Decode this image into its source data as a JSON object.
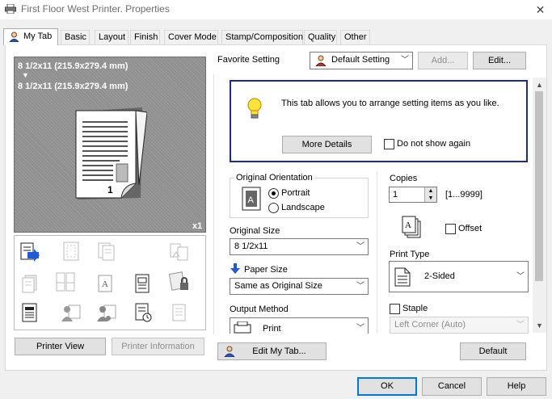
{
  "window": {
    "title": "First Floor West Printer. Properties",
    "close_glyph": "✕"
  },
  "tabs": [
    {
      "label": "My Tab",
      "active": true
    },
    {
      "label": "Basic"
    },
    {
      "label": "Layout"
    },
    {
      "label": "Finish"
    },
    {
      "label": "Cover Mode"
    },
    {
      "label": "Stamp/Composition"
    },
    {
      "label": "Quality"
    },
    {
      "label": "Other"
    }
  ],
  "preview": {
    "size_line_1": "8 1/2x11 (215.9x279.4 mm)",
    "arrow": "▼",
    "size_line_2": "8 1/2x11 (215.9x279.4 mm)",
    "page_number": "1",
    "copies_marker": "x1"
  },
  "left_buttons": {
    "printer_view": "Printer View",
    "printer_information": "Printer Information"
  },
  "favorite": {
    "label": "Favorite Setting",
    "value": "Default Setting",
    "add": "Add...",
    "edit": "Edit..."
  },
  "info": {
    "message": "This tab allows you to arrange setting items as you like.",
    "more_details": "More Details",
    "do_not_show": "Do not show again"
  },
  "orientation": {
    "group_label": "Original Orientation",
    "portrait": "Portrait",
    "landscape": "Landscape",
    "selected": "Portrait"
  },
  "original_size": {
    "label": "Original Size",
    "value": "8 1/2x11"
  },
  "paper_size": {
    "label": "Paper Size",
    "value": "Same as Original Size"
  },
  "output_method": {
    "label": "Output Method",
    "value": "Print"
  },
  "copies": {
    "label": "Copies",
    "value": "1",
    "range": "[1...9999]"
  },
  "offset": {
    "label": "Offset"
  },
  "print_type": {
    "label": "Print Type",
    "value": "2-Sided"
  },
  "staple": {
    "label": "Staple",
    "value": "Left Corner (Auto)"
  },
  "bottom_buttons": {
    "edit_my_tab": "Edit My Tab...",
    "default": "Default"
  },
  "dialog_buttons": {
    "ok": "OK",
    "cancel": "Cancel",
    "help": "Help"
  },
  "colors": {
    "accent_blue": "#0078d7",
    "info_border": "#1b2a8f",
    "preview_bg": "#8f8f8f"
  }
}
